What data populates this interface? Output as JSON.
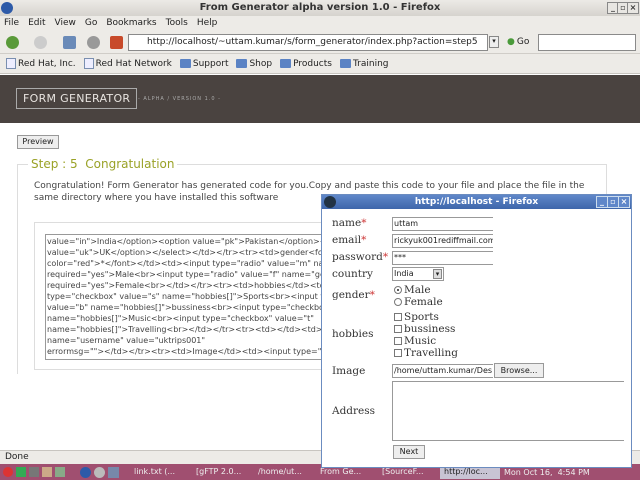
{
  "window": {
    "title": "From Generator alpha version 1.0 - Firefox"
  },
  "menu": [
    "File",
    "Edit",
    "View",
    "Go",
    "Bookmarks",
    "Tools",
    "Help"
  ],
  "nav": {
    "url": "http://localhost/~uttam.kumar/s/form_generator/index.php?action=step5",
    "go_label": "Go"
  },
  "bookmarks": [
    {
      "label": "Red Hat, Inc.",
      "icon": "page"
    },
    {
      "label": "Red Hat Network",
      "icon": "page"
    },
    {
      "label": "Support",
      "icon": "folder"
    },
    {
      "label": "Shop",
      "icon": "folder"
    },
    {
      "label": "Products",
      "icon": "folder"
    },
    {
      "label": "Training",
      "icon": "folder"
    }
  ],
  "header": {
    "logo": "FORM GENERATOR",
    "tagline": "- ALPHA / VERSION 1.0 -"
  },
  "main": {
    "preview_label": "Preview",
    "step_title": "Step : 5  Congratulation",
    "intro": "Congratulation! Form Generator has generated code for you.Copy and paste this code to your file and place the file in the same directory where you have installed this software",
    "code_lines": [
      "value=\"in\">India</option><option value=\"pk\">Pakistan</option><option",
      "value=\"uk\">UK</option></select></td></tr><tr><td>gender<font",
      "color=\"red\">*</font></td><td><input type=\"radio\" value=\"m\" name=",
      "required=\"yes\">Male<br><input type=\"radio\" value=\"f\" name=\"gender\"",
      "required=\"yes\">Female<br></td></tr><tr><td>hobbies</td><td><input",
      "type=\"checkbox\" value=\"s\" name=\"hobbies[]\">Sports<br><input type=\"checkbox\"",
      "value=\"b\" name=\"hobbies[]\">bussiness<br><input type=\"checkbox\" value=\"m\"",
      "name=\"hobbies[]\">Music<br><input type=\"checkbox\" value=\"t\"",
      "name=\"hobbies[]\">Travelling<br></td></tr><tr><td></td><td><input",
      "name=\"username\" value=\"uktrips001\"",
      "errormsg=\"\"></td></tr><tr><td>Image</td><td><input type=\"file\""
    ]
  },
  "popup": {
    "title": "http://localhost - Firefox",
    "fields": {
      "name_label": "name",
      "name_value": "uttam",
      "email_label": "email",
      "email_value": "rickyuk001rediffmail.com",
      "password_label": "password",
      "password_value": "***",
      "country_label": "country",
      "country_value": "India",
      "gender_label": "gender",
      "gender_options": [
        "Male",
        "Female"
      ],
      "gender_selected": "Male",
      "hobbies_label": "hobbies",
      "hobbies_options": [
        "Sports",
        "bussiness",
        "Music",
        "Travelling"
      ],
      "image_label": "Image",
      "image_value": "/home/uttam.kumar/Des",
      "browse_label": "Browse...",
      "address_label": "Address",
      "address_value": "",
      "next_label": "Next",
      "required_mark": "*"
    }
  },
  "status": {
    "text": "Done"
  },
  "taskbar": {
    "items": [
      "link.txt (...",
      "[gFTP 2.0...",
      "/home/ut...",
      "From Ge...",
      "[SourceF...",
      "http://loc..."
    ],
    "active": "http://loc...",
    "clock": "Mon Oct 16,  4:54 PM"
  }
}
